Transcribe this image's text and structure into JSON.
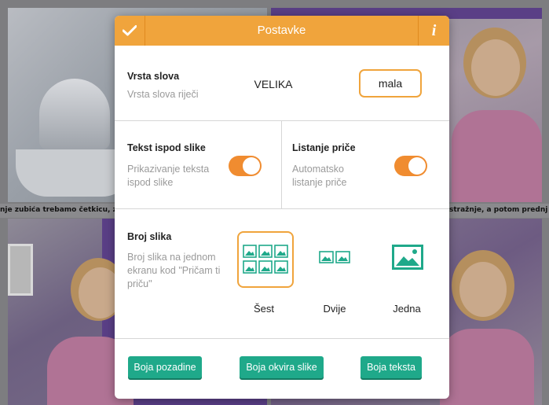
{
  "background": {
    "caption_left": "nje zubića trebamo četkicu, zub",
    "caption_right": "stražnje, a potom prednj"
  },
  "modal": {
    "title": "Postavke",
    "confirm_icon": "checkmark-icon",
    "info_label": "i",
    "font_type": {
      "title": "Vrsta slova",
      "subtitle": "Vrsta slova riječi",
      "option_upper": "VELIKA",
      "option_lower": "mala",
      "selected": "mala"
    },
    "text_below": {
      "title": "Tekst ispod slike",
      "subtitle": "Prikazivanje teksta ispod slike",
      "on": true
    },
    "story_paging": {
      "title": "Listanje priče",
      "subtitle": "Automatsko listanje priče",
      "on": true
    },
    "image_count": {
      "title": "Broj slika",
      "subtitle": "Broj slika na jednom ekranu kod \"Pričam ti priču\"",
      "options": [
        "Šest",
        "Dvije",
        "Jedna"
      ],
      "selected": "Šest"
    },
    "buttons": {
      "background_color": "Boja pozadine",
      "frame_color": "Boja okvira slike",
      "text_color": "Boja teksta"
    }
  },
  "colors": {
    "accent_orange": "#f0a43c",
    "toggle_orange": "#f08c30",
    "teal": "#1fa98a"
  }
}
